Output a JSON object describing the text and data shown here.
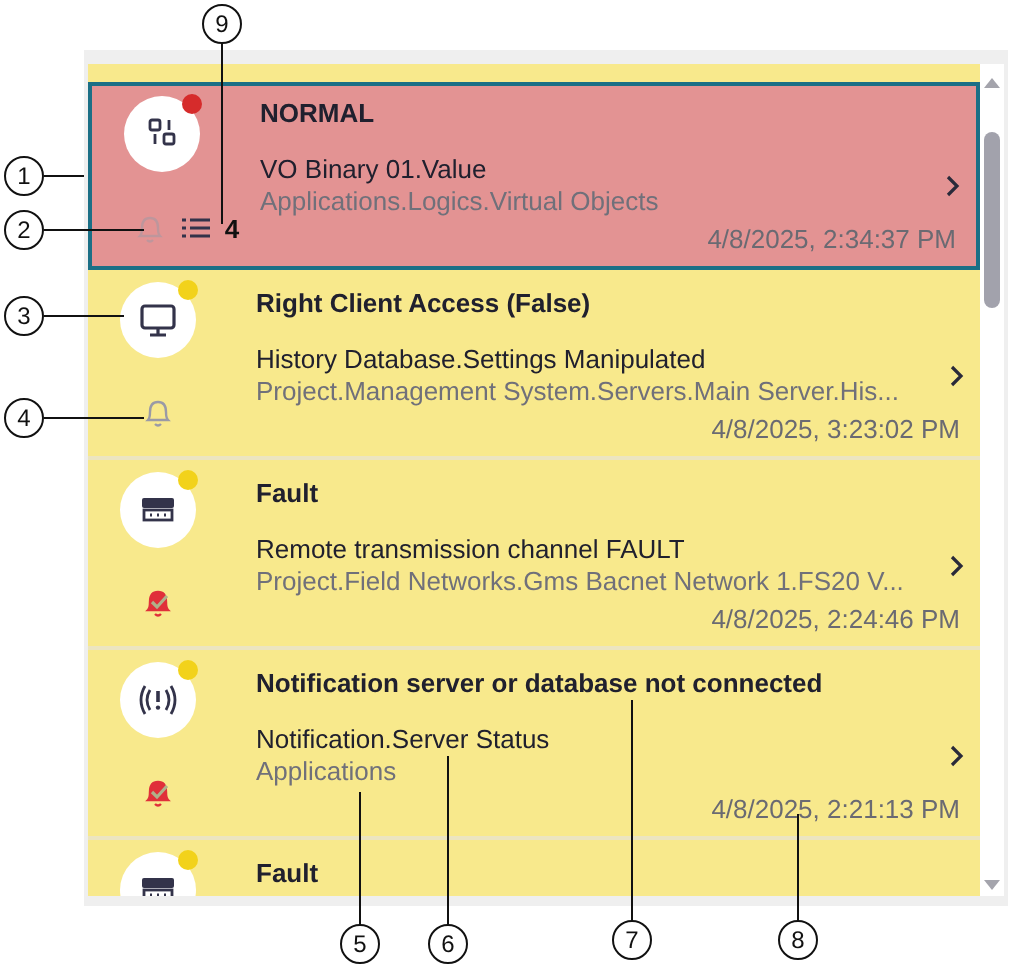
{
  "alarms": [
    {
      "title": "NORMAL",
      "source": "VO Binary 01.Value",
      "path": "Applications.Logics.Virtual Objects",
      "time": "4/8/2025, 2:34:37 PM",
      "kind": "logic",
      "color": "#d62b2b",
      "acknowledged": false,
      "bell_disabled": true,
      "event_count": "4",
      "selected": true
    },
    {
      "title": "Right Client Access (False)",
      "source": "History Database.Settings Manipulated",
      "path": "Project.Management System.Servers.Main Server.His...",
      "time": "4/8/2025, 3:23:02 PM",
      "kind": "workstation",
      "color": "#f2d21b",
      "acknowledged": false,
      "bell_disabled": false,
      "selected": false
    },
    {
      "title": "Fault",
      "source": "Remote transmission channel FAULT",
      "path": "Project.Field Networks.Gms Bacnet Network 1.FS20 V...",
      "time": "4/8/2025, 2:24:46 PM",
      "kind": "detector",
      "color": "#f2d21b",
      "acknowledged": true,
      "bell_disabled": false,
      "selected": false
    },
    {
      "title": "Notification server or database not connected",
      "source": "Notification.Server Status",
      "path": "Applications",
      "time": "4/8/2025, 2:21:13 PM",
      "kind": "wireless",
      "color": "#f2d21b",
      "acknowledged": true,
      "bell_disabled": false,
      "selected": false
    },
    {
      "title": "Fault",
      "kind": "detector",
      "color": "#f2d21b",
      "selected": false
    }
  ],
  "callouts": [
    {
      "label": "1"
    },
    {
      "label": "2"
    },
    {
      "label": "3"
    },
    {
      "label": "4"
    },
    {
      "label": "5"
    },
    {
      "label": "6"
    },
    {
      "label": "7"
    },
    {
      "label": "8"
    },
    {
      "label": "9"
    }
  ]
}
